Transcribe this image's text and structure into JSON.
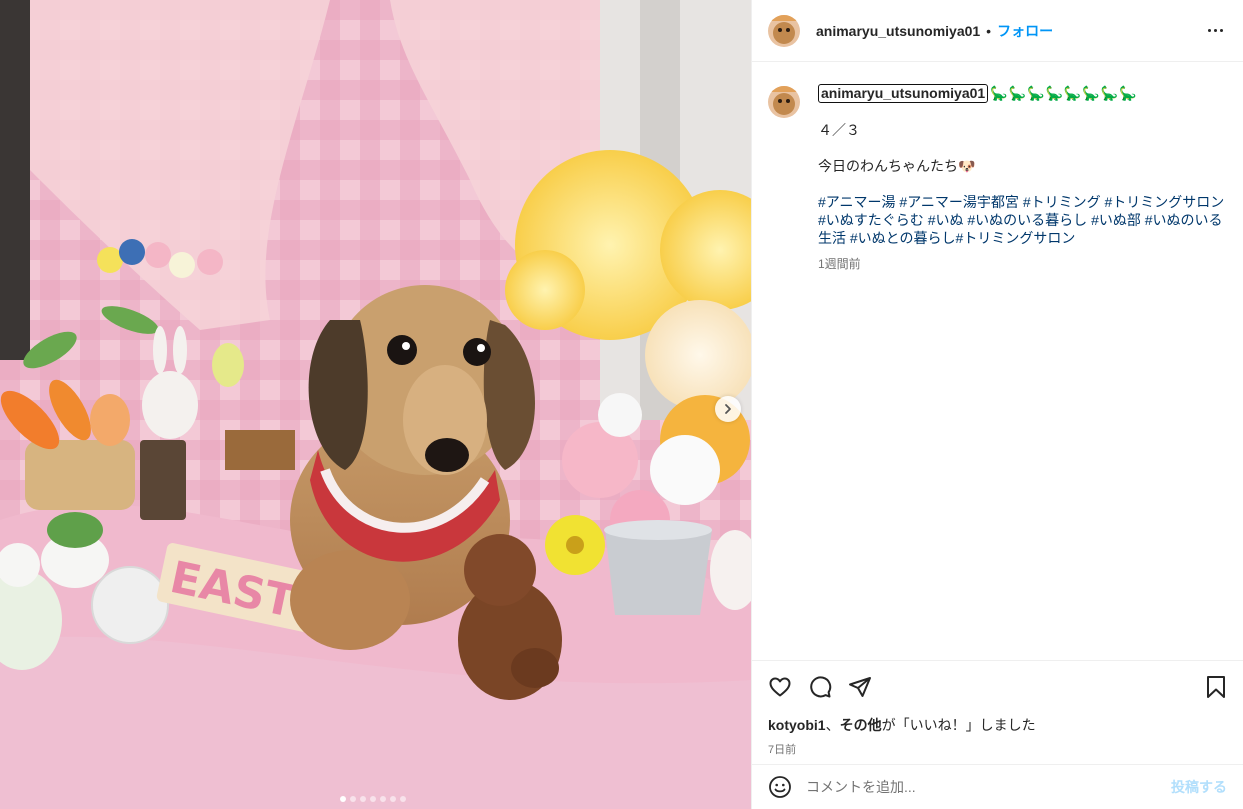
{
  "post": {
    "username": "animaryu_utsunomiya01",
    "separator": "•",
    "follow_label": "フォロー",
    "caption": {
      "dinosaurs": "🦕🦕🦕🦕🦕🦕🦕🦕",
      "date": "４／３",
      "today": "今日のわんちゃんたち🐶",
      "hashtags": [
        "#アニマー湯",
        "#アニマー湯宇都宮",
        "#トリミング",
        "#トリミングサロン",
        "#いぬすたぐらむ",
        "#いぬ",
        "#いぬのいる暮らし",
        "#いぬ部",
        "#いぬのいる生活",
        "#いぬとの暮らし",
        "#トリミングサロン"
      ],
      "time_ago": "1週間前"
    },
    "likes": {
      "user": "kotyobi1",
      "mid": "、",
      "others": "その他",
      "suffix": "が「いいね！」しました"
    },
    "posted_ago": "7日前",
    "comment_placeholder": "コメントを追加...",
    "post_button": "投稿する"
  },
  "carousel": {
    "total": 7,
    "active_index": 0
  },
  "icons": {
    "like": "heart-icon",
    "comment": "comment-icon",
    "share": "share-icon",
    "save": "bookmark-icon",
    "emoji": "emoji-icon",
    "more": "more-options-icon",
    "next": "chevron-right-icon"
  },
  "colors": {
    "link": "#0095f6",
    "hashtag": "#00376b",
    "muted": "#737373",
    "dinos": "#1fa34a"
  }
}
